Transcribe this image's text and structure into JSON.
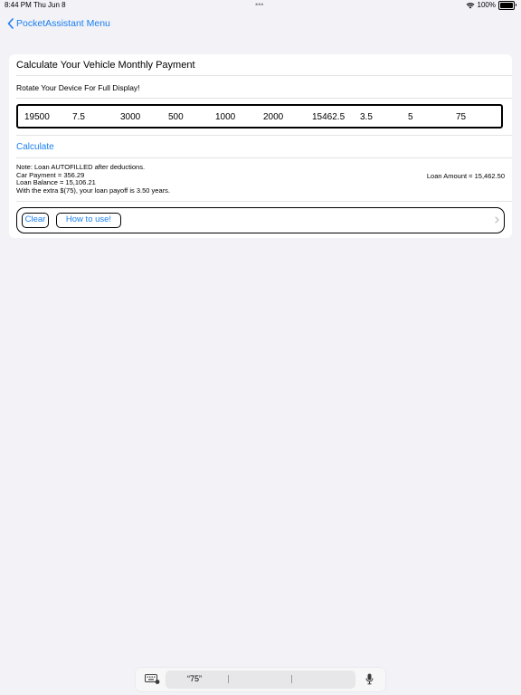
{
  "status": {
    "time": "8:44 PM",
    "date": "Thu Jun 8",
    "dots": "•••",
    "battery": "100%",
    "battery_level": 1.0
  },
  "nav": {
    "back_label": "PocketAssistant Menu"
  },
  "card": {
    "title": "Calculate Your Vehicle Monthly Payment",
    "rotate_hint": "Rotate Your Device For Full Display!",
    "values": [
      "19500",
      "7.5",
      "3000",
      "500",
      "1000",
      "2000",
      "15462.5",
      "3.5",
      "5",
      "75"
    ],
    "calculate_label": "Calculate",
    "notes": [
      "Note: Loan AUTOFILLED after deductions.",
      "Car Payment = 356.29",
      "Loan Balance = 15,106.21",
      "With the extra $(75), your loan payoff is 3.50 years."
    ],
    "loan_amount": "Loan Amount = 15,462.50",
    "clear_label": "Clear",
    "how_to_label": "How to use!"
  },
  "keyboard": {
    "suggestion": "“75”"
  },
  "colors": {
    "accent": "#1a7ff0",
    "background": "#f2f2f7"
  }
}
